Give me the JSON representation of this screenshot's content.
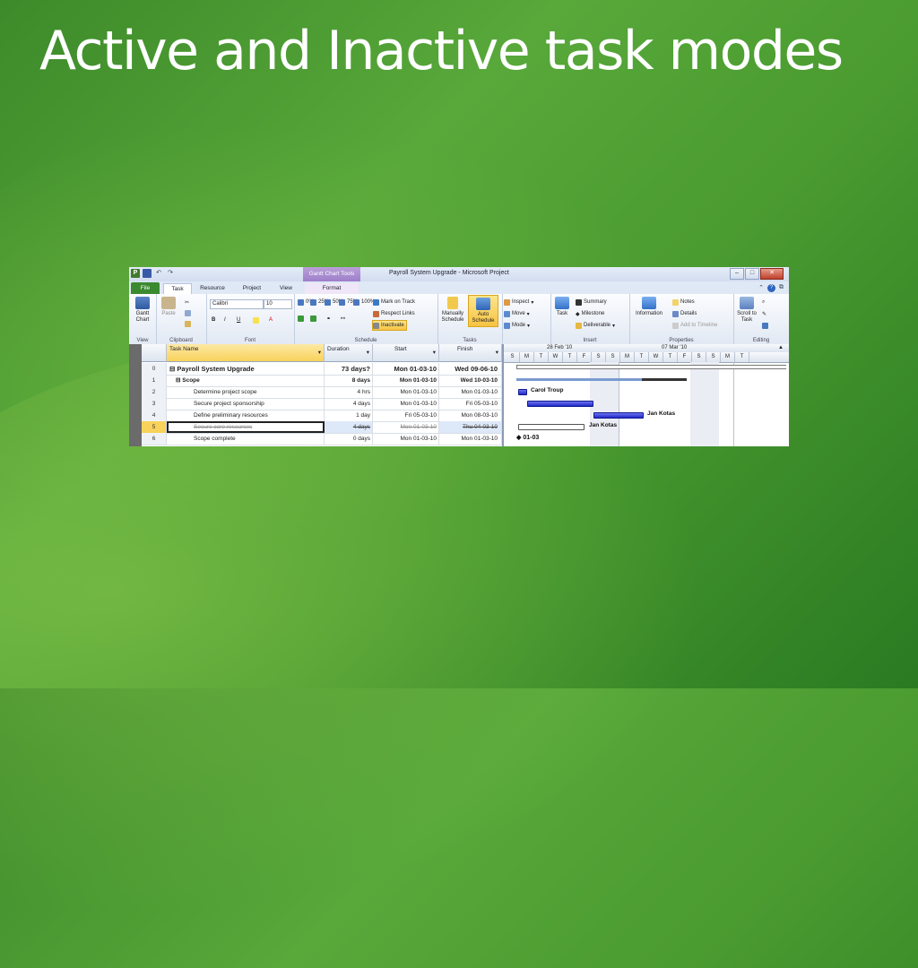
{
  "slide": {
    "title": "Active and Inactive task modes"
  },
  "window": {
    "title": "Payroll System Upgrade - Microsoft Project",
    "context_tab": "Gantt Chart Tools"
  },
  "tabs": {
    "file": "File",
    "task": "Task",
    "resource": "Resource",
    "project": "Project",
    "view": "View",
    "format": "Format"
  },
  "ribbon": {
    "view": {
      "gantt_chart": "Gantt Chart",
      "label": "View"
    },
    "clipboard": {
      "paste": "Paste",
      "label": "Clipboard"
    },
    "font": {
      "name": "Calibri",
      "size": "10",
      "bold": "B",
      "italic": "I",
      "underline": "U",
      "label": "Font"
    },
    "schedule": {
      "mark_on_track": "Mark on Track",
      "respect_links": "Respect Links",
      "inactivate": "Inactivate",
      "label": "Schedule",
      "pct": [
        "0%",
        "25%",
        "50%",
        "75%",
        "100%"
      ]
    },
    "tasks": {
      "manually_schedule": "Manually Schedule",
      "auto_schedule": "Auto Schedule",
      "inspect": "Inspect",
      "move": "Move",
      "mode": "Mode",
      "label": "Tasks"
    },
    "insert": {
      "task": "Task",
      "summary": "Summary",
      "milestone": "Milestone",
      "deliverable": "Deliverable",
      "label": "Insert"
    },
    "properties": {
      "information": "Information",
      "notes": "Notes",
      "details": "Details",
      "add_to_timeline": "Add to Timeline",
      "label": "Properties"
    },
    "editing": {
      "scroll_to_task": "Scroll to Task",
      "label": "Editing"
    }
  },
  "table": {
    "headers": {
      "task_name": "Task Name",
      "duration": "Duration",
      "start": "Start",
      "finish": "Finish"
    },
    "rows": [
      {
        "id": "0",
        "name": "Payroll System Upgrade",
        "duration": "73 days?",
        "start": "Mon 01-03-10",
        "finish": "Wed 09-06-10"
      },
      {
        "id": "1",
        "name": "Scope",
        "duration": "8 days",
        "start": "Mon 01-03-10",
        "finish": "Wed 10-03-10"
      },
      {
        "id": "2",
        "name": "Determine project scope",
        "duration": "4 hrs",
        "start": "Mon 01-03-10",
        "finish": "Mon 01-03-10"
      },
      {
        "id": "3",
        "name": "Secure project sponsorship",
        "duration": "4 days",
        "start": "Mon 01-03-10",
        "finish": "Fri 05-03-10"
      },
      {
        "id": "4",
        "name": "Define preliminary resources",
        "duration": "1 day",
        "start": "Fri 05-03-10",
        "finish": "Mon 08-03-10"
      },
      {
        "id": "5",
        "name": "Secure core resources",
        "duration": "4 days",
        "start": "Mon 01-03-10",
        "finish": "Thu 04-03-10"
      },
      {
        "id": "6",
        "name": "Scope complete",
        "duration": "0 days",
        "start": "Mon 01-03-10",
        "finish": "Mon 01-03-10"
      }
    ]
  },
  "gantt": {
    "weeks": [
      "28 Feb '10",
      "07 Mar '10"
    ],
    "days": [
      "S",
      "M",
      "T",
      "W",
      "T",
      "F",
      "S",
      "S",
      "M",
      "T",
      "W",
      "T",
      "F",
      "S",
      "S",
      "M",
      "T"
    ],
    "labels": {
      "carol": "Carol Troup",
      "jan1": "Jan Kotas",
      "jan2": "Jan Kotas",
      "milestone": "01-03"
    }
  }
}
